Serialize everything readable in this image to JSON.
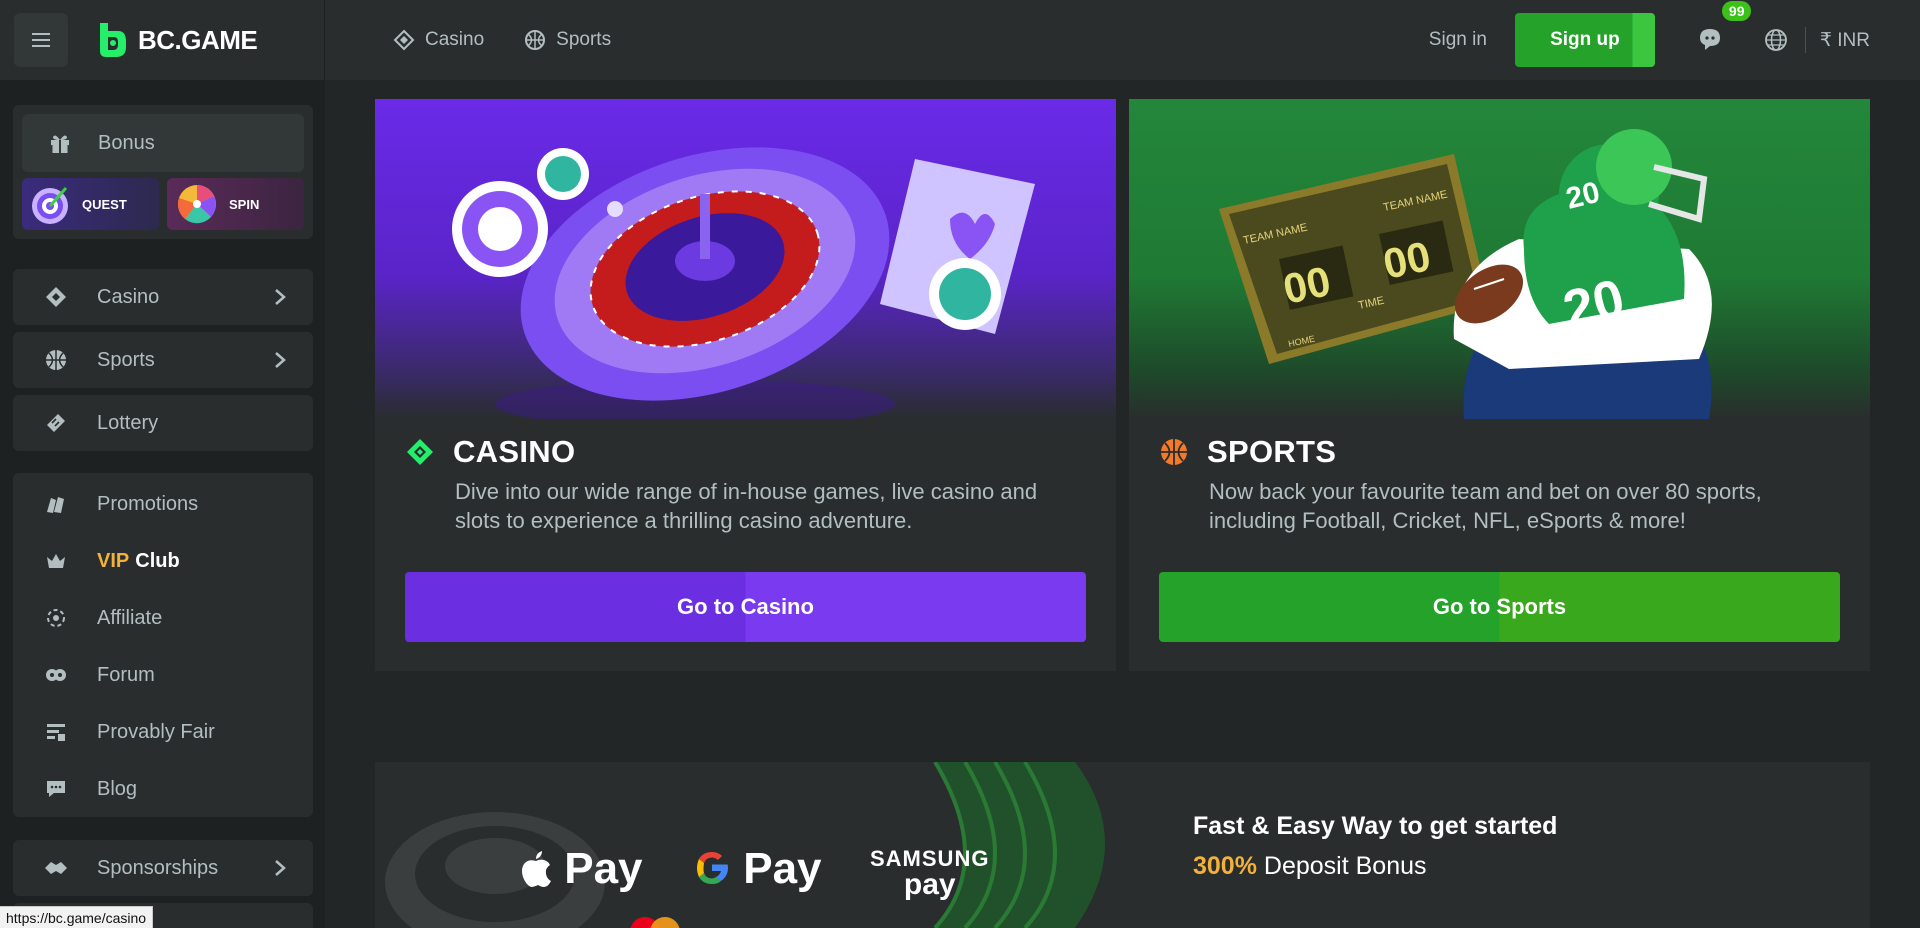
{
  "header": {
    "logo_text": "BC.GAME",
    "nav": [
      {
        "label": "Casino",
        "icon": "casino-icon"
      },
      {
        "label": "Sports",
        "icon": "sports-icon"
      }
    ],
    "sign_in": "Sign in",
    "sign_up": "Sign up",
    "chat_badge": "99",
    "currency": "₹ INR",
    "colors": {
      "bg": "#292d2e",
      "signup": "#24a22a",
      "badge": "#3bc117"
    }
  },
  "sidebar": {
    "bonus": "Bonus",
    "quest": "QUEST",
    "spin": "SPIN",
    "primary": [
      {
        "label": "Casino",
        "icon": "casino-icon",
        "has_chevron": true
      },
      {
        "label": "Sports",
        "icon": "sports-icon",
        "has_chevron": true
      },
      {
        "label": "Lottery",
        "icon": "lottery-icon",
        "has_chevron": false
      }
    ],
    "secondary": [
      {
        "label": "Promotions",
        "icon": "promotions-icon"
      },
      {
        "label_vip": "VIP",
        "label_club": "Club",
        "icon": "crown-icon"
      },
      {
        "label": "Affiliate",
        "icon": "affiliate-icon"
      },
      {
        "label": "Forum",
        "icon": "forum-icon"
      },
      {
        "label": "Provably Fair",
        "icon": "provably-fair-icon"
      },
      {
        "label": "Blog",
        "icon": "blog-icon"
      }
    ],
    "sponsorships": "Sponsorships"
  },
  "cards": {
    "casino": {
      "title": "CASINO",
      "description": "Dive into our wide range of in-house games, live casino and slots to experience a thrilling casino adventure.",
      "button": "Go to Casino",
      "color": "#6b2ee0"
    },
    "sports": {
      "title": "SPORTS",
      "description": "Now back your favourite team and bet on over 80 sports, including Football, Cricket, NFL, eSports & more!",
      "button": "Go to Sports",
      "color": "#24a22a",
      "scoreboard": {
        "team_name": "TEAM NAME",
        "score": "00",
        "time_label": "TIME",
        "home_label": "HOME"
      },
      "jersey_number": "20"
    }
  },
  "payment_banner": {
    "logos": [
      "Pay",
      "Pay",
      "SAMSUNG",
      "pay"
    ],
    "title": "Fast & Easy Way to get started",
    "bonus_highlight": "300%",
    "bonus_text": "Deposit Bonus"
  },
  "status_url": "https://bc.game/casino"
}
